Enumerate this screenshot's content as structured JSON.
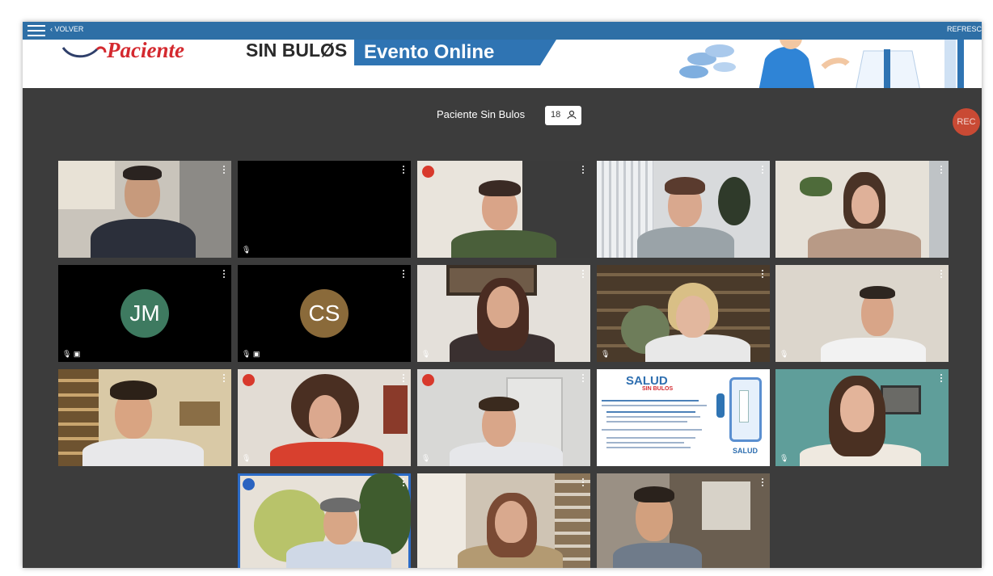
{
  "topbar": {
    "back_label": "‹ VOLVER",
    "refresh_label": "REFRESC"
  },
  "banner": {
    "logo_paciente": "Paciente",
    "logo_sinbulos": "SIN BULØS",
    "event_label": "Evento Online"
  },
  "session": {
    "title": "Paciente Sin Bulos",
    "participant_count": "18"
  },
  "rec_label": "REC",
  "avatars": [
    {
      "initials": "JM",
      "color": "#3e7a60"
    },
    {
      "initials": "CS",
      "color": "#8a6a3a"
    }
  ],
  "slide": {
    "logo": "SALUD",
    "sub": "SIN BULOS",
    "footer_logo": "SALUD"
  },
  "colors": {
    "accent": "#2e6fa6",
    "rec": "#c94a34",
    "speaking": "#d8392c",
    "stage_bg": "#3c3c3c"
  }
}
